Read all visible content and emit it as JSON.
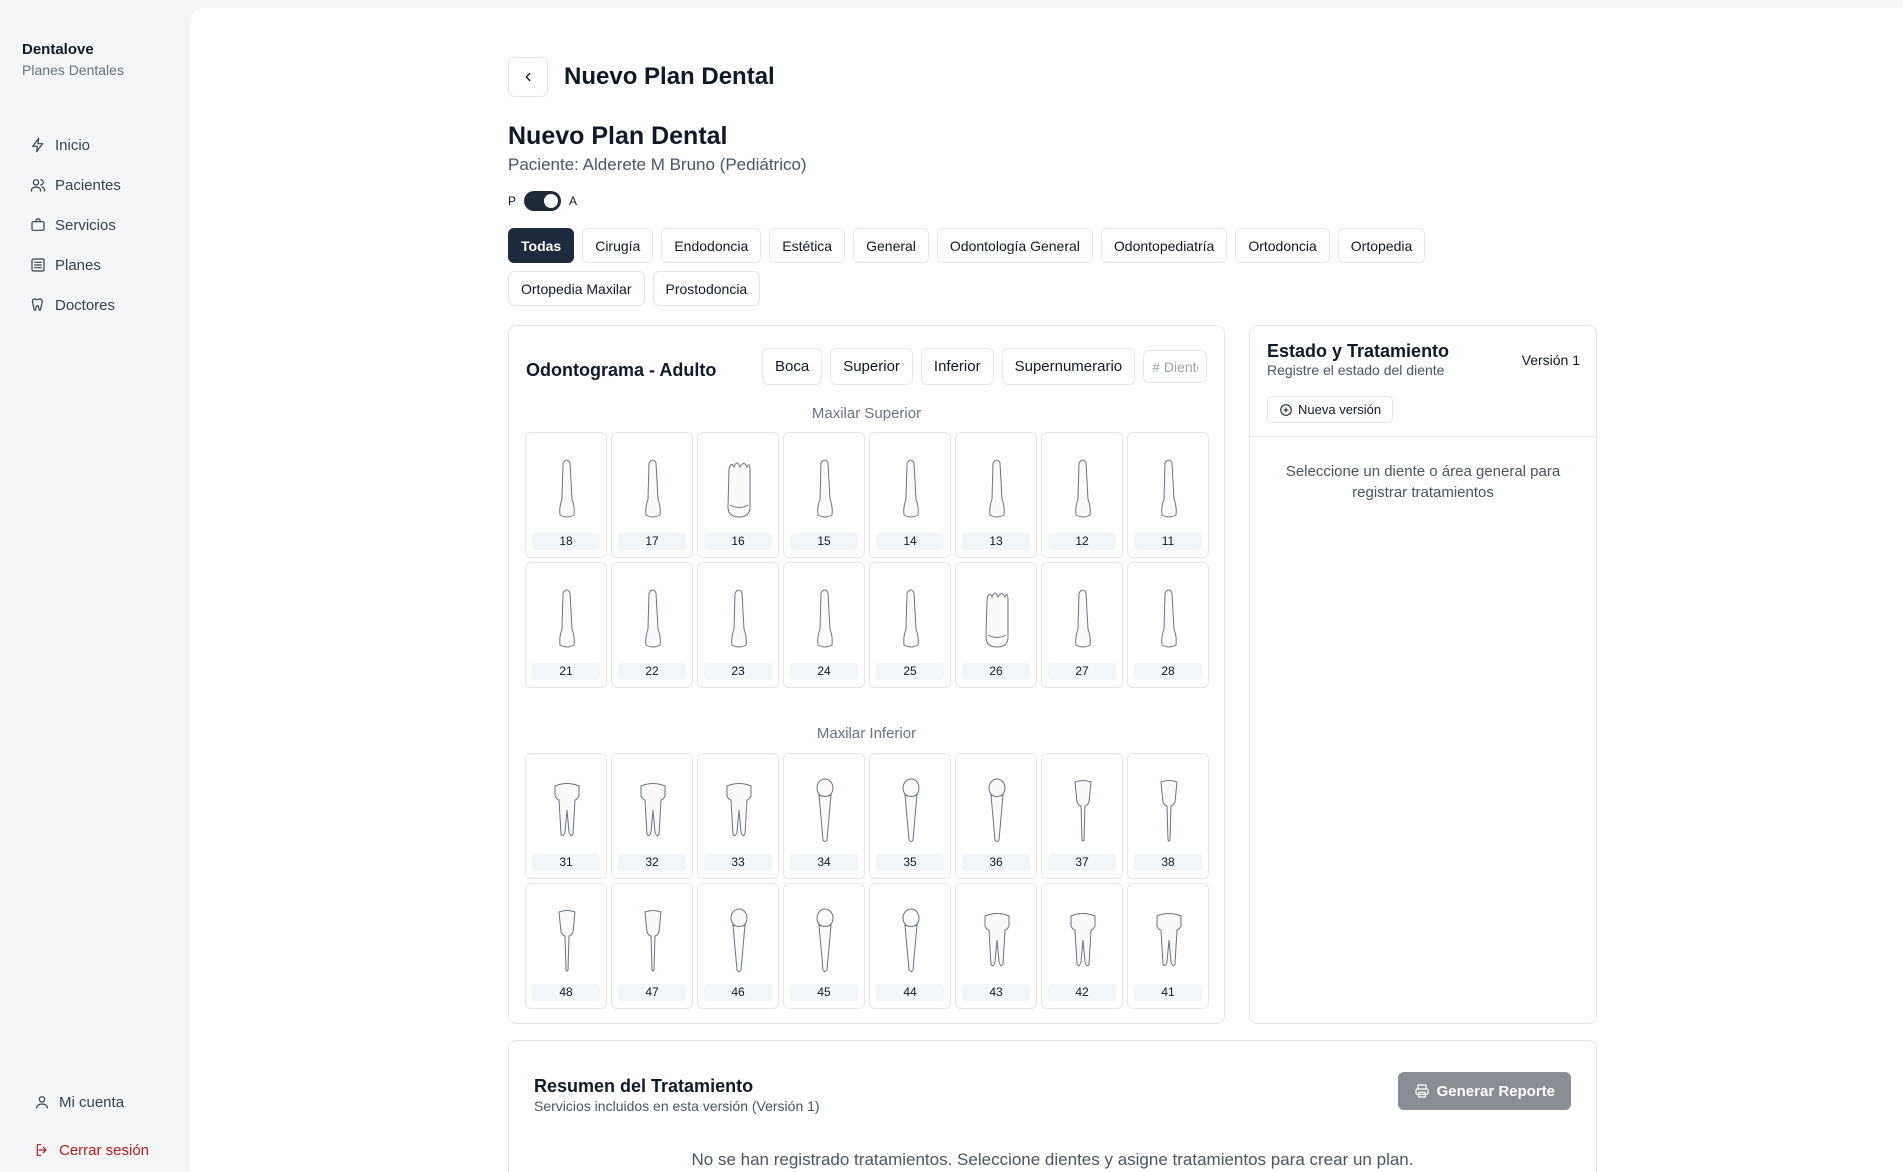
{
  "brand": {
    "name": "Dentalove",
    "subtitle": "Planes Dentales"
  },
  "nav": {
    "items": [
      {
        "label": "Inicio",
        "icon": "zap-icon"
      },
      {
        "label": "Pacientes",
        "icon": "users-icon"
      },
      {
        "label": "Servicios",
        "icon": "briefcase-icon"
      },
      {
        "label": "Planes",
        "icon": "list-icon"
      },
      {
        "label": "Doctores",
        "icon": "tooth-icon"
      }
    ],
    "account": "Mi cuenta",
    "logout": "Cerrar sesión"
  },
  "header": {
    "title": "Nuevo Plan Dental"
  },
  "plan": {
    "title": "Nuevo Plan Dental",
    "patient": "Paciente: Alderete M Bruno (Pediátrico)",
    "toggle_left": "P",
    "toggle_right": "A"
  },
  "filters": [
    "Todas",
    "Cirugía",
    "Endodoncia",
    "Estética",
    "General",
    "Odontología General",
    "Odontopediatría",
    "Ortodoncia",
    "Ortopedia",
    "Ortopedia Maxilar",
    "Prostodoncia"
  ],
  "odontogram": {
    "title": "Odontograma - Adulto",
    "buttons": {
      "boca": "Boca",
      "superior": "Superior",
      "inferior": "Inferior",
      "supernumerario": "Supernumerario"
    },
    "search_placeholder": "# Diente",
    "upper_label": "Maxilar Superior",
    "lower_label": "Maxilar Inferior",
    "upper_row1": [
      "18",
      "17",
      "16",
      "15",
      "14",
      "13",
      "12",
      "11"
    ],
    "upper_row2": [
      "21",
      "22",
      "23",
      "24",
      "25",
      "26",
      "27",
      "28"
    ],
    "lower_row1": [
      "31",
      "32",
      "33",
      "34",
      "35",
      "36",
      "37",
      "38"
    ],
    "lower_row2": [
      "48",
      "47",
      "46",
      "45",
      "44",
      "43",
      "42",
      "41"
    ]
  },
  "estado": {
    "title": "Estado y Tratamiento",
    "subtitle": "Registre el estado del diente",
    "version": "Versión 1",
    "new_version": "Nueva versión",
    "empty": "Seleccione un diente o área general para registrar tratamientos"
  },
  "resumen": {
    "title": "Resumen del Tratamiento",
    "subtitle": "Servicios incluidos en esta versión (Versión 1)",
    "report_button": "Generar Reporte",
    "empty": "No se han registrado tratamientos. Seleccione dientes y asigne tratamientos para crear un plan."
  },
  "colors": {
    "active_chip": "#1f2a3c",
    "logout": "#b91c1c",
    "report_button": "#8a8e94"
  }
}
